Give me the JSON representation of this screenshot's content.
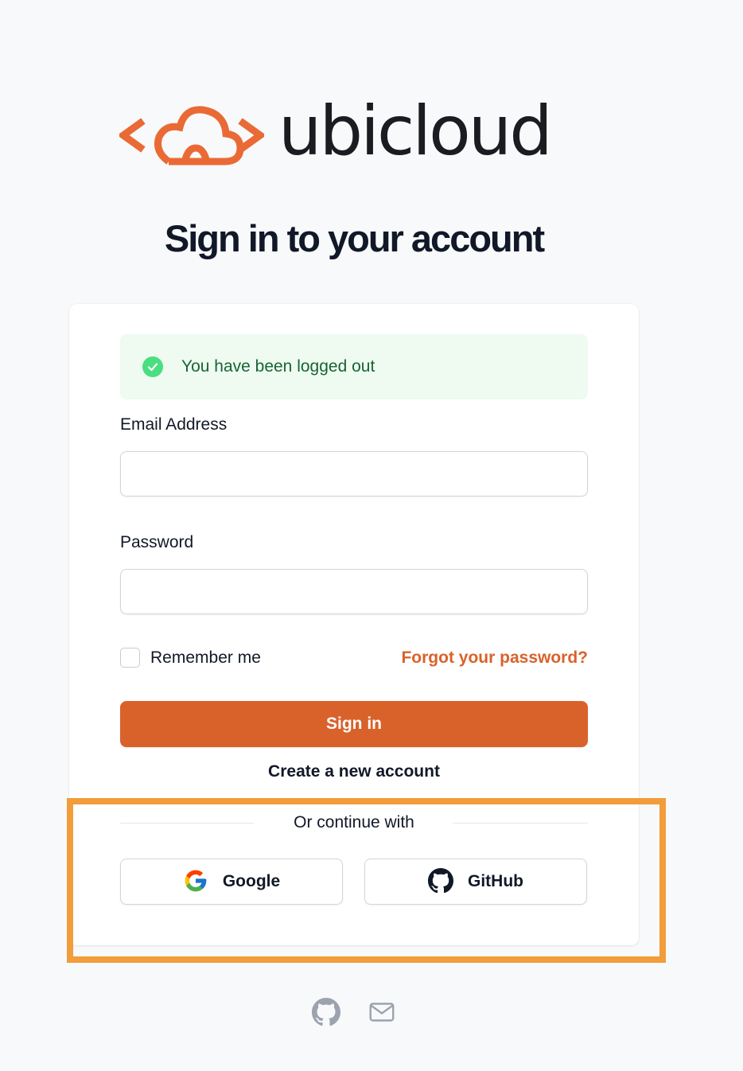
{
  "brand": {
    "name": "ubicloud",
    "accent": "#d9622b",
    "logo_color": "#ea6a35"
  },
  "page": {
    "title": "Sign in to your account"
  },
  "alert": {
    "message": "You have been logged out",
    "icon": "check-circle-icon",
    "color": "#4ade80"
  },
  "form": {
    "email_label": "Email Address",
    "email_value": "",
    "password_label": "Password",
    "password_value": "",
    "remember_label": "Remember me",
    "remember_checked": false,
    "forgot_label": "Forgot your password?",
    "submit_label": "Sign in",
    "create_account_label": "Create a new account"
  },
  "social": {
    "divider_label": "Or continue with",
    "google_label": "Google",
    "github_label": "GitHub"
  },
  "footer": {
    "icons": [
      "github-icon",
      "mail-icon"
    ]
  },
  "highlight_color": "#f29c3a"
}
